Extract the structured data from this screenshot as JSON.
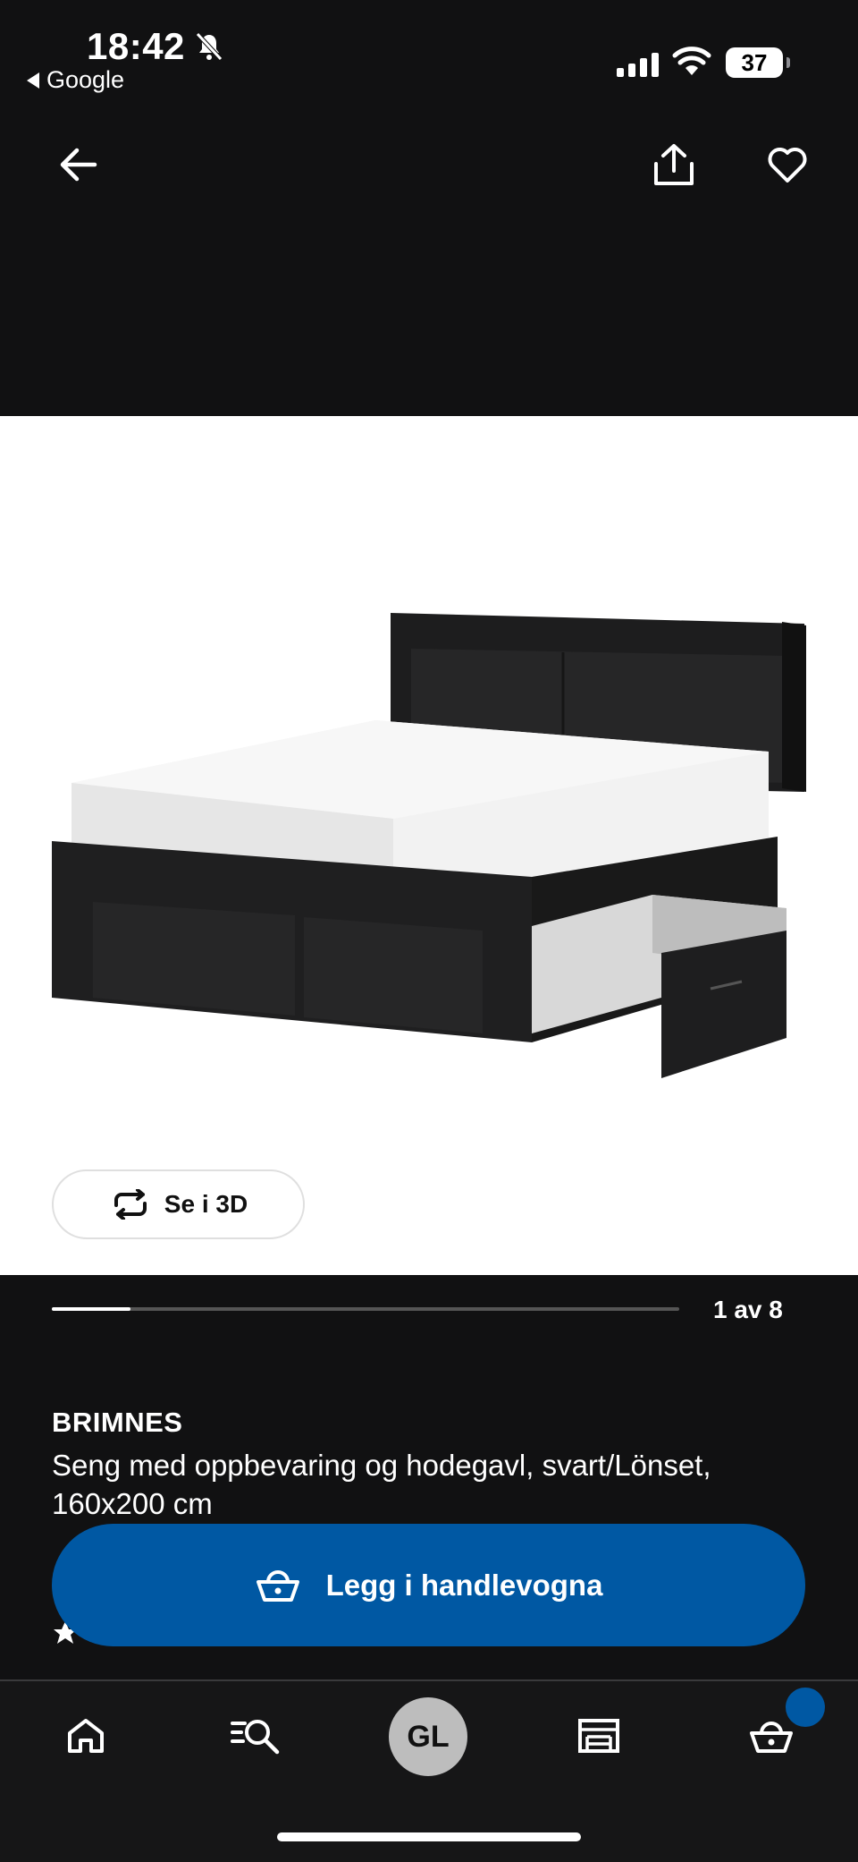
{
  "status_bar": {
    "time": "18:42",
    "back_app": "Google",
    "battery": "37"
  },
  "nav": {
    "back_icon": "arrow-left-icon",
    "share_icon": "share-icon",
    "favorite_icon": "heart-icon"
  },
  "gallery": {
    "view_3d_label": "Se i 3D",
    "counter": "1 av 8",
    "progress": 0.125
  },
  "product": {
    "name": "BRIMNES",
    "description": "Seng med oppbevaring og hodegavl, svart/Lönset, 160x200 cm"
  },
  "cart_button": {
    "label": "Legg i handlevogna",
    "icon": "basket-icon"
  },
  "tabbar": {
    "profile_initials": "GL",
    "items": [
      "home-icon",
      "search-icon",
      "profile-avatar",
      "store-icon",
      "basket-icon"
    ]
  },
  "colors": {
    "accent": "#0058a3",
    "background": "#111112"
  }
}
